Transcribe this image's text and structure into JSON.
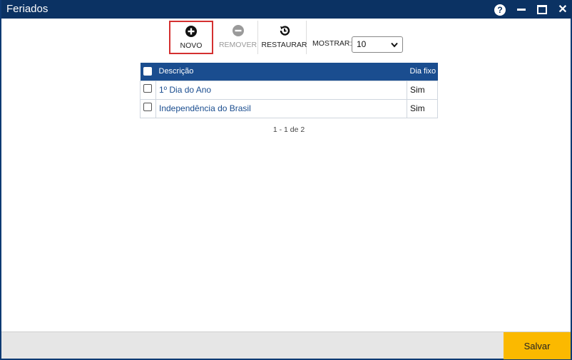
{
  "window": {
    "title": "Feriados"
  },
  "titlebar": {
    "help_label": "?",
    "close_label": "✕"
  },
  "toolbar": {
    "novo_label": "NOVO",
    "remover_label": "REMOVER",
    "restaurar_label": "RESTAURAR",
    "mostrar_label": "MOSTRAR:",
    "mostrar_value": "10"
  },
  "table": {
    "columns": {
      "descricao": "Descrição",
      "dia_fixo": "Dia fixo"
    },
    "rows": [
      {
        "descricao": "1º Dia do Ano",
        "dia_fixo": "Sim"
      },
      {
        "descricao": "Independência do Brasil",
        "dia_fixo": "Sim"
      }
    ]
  },
  "pager": {
    "text": "1 - 1 de 2"
  },
  "footer": {
    "salvar_label": "Salvar"
  },
  "colors": {
    "titlebar": "#0b3263",
    "header": "#1a4d8f",
    "link": "#1a4d8f",
    "salvar": "#fbb900",
    "highlight": "#d43030"
  }
}
